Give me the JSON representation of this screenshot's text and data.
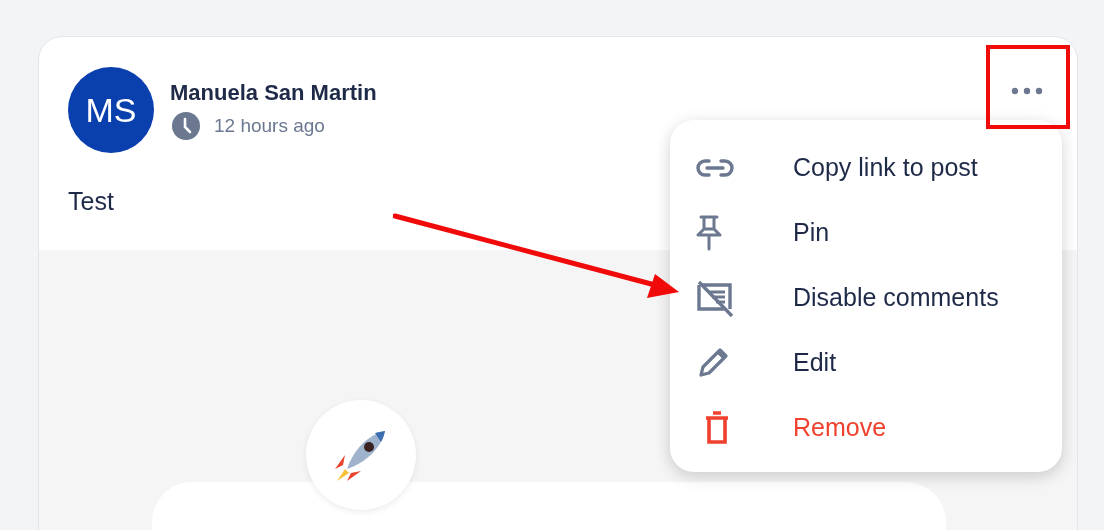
{
  "post": {
    "author": {
      "initials": "MS",
      "name": "Manuela San Martin"
    },
    "time": "12 hours ago",
    "text": "Test"
  },
  "menu": {
    "items": [
      {
        "kind": "link",
        "label": "Copy link to post",
        "danger": false
      },
      {
        "kind": "pin",
        "label": "Pin",
        "danger": false
      },
      {
        "kind": "disable-comments",
        "label": "Disable comments",
        "danger": false
      },
      {
        "kind": "edit",
        "label": "Edit",
        "danger": false
      },
      {
        "kind": "remove",
        "label": "Remove",
        "danger": true
      }
    ]
  }
}
